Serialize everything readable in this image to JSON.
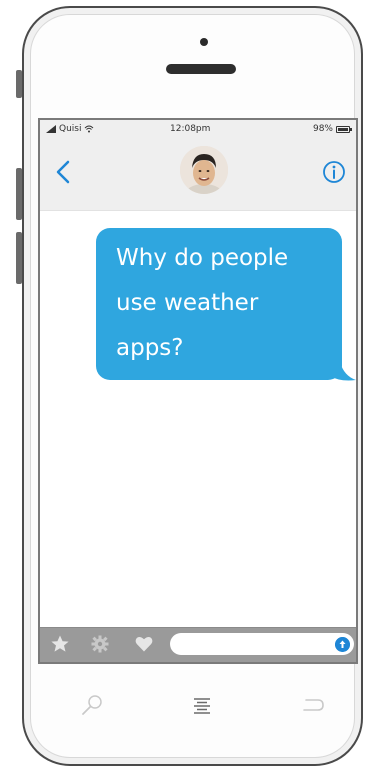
{
  "status_bar": {
    "carrier": "Quisi",
    "time": "12:08pm",
    "battery": "98%"
  },
  "header": {
    "back_icon": "chevron-left-icon",
    "info_icon": "info-circle-icon",
    "avatar_icon": "contact-avatar"
  },
  "conversation": {
    "messages": [
      {
        "sender": "me",
        "lines": [
          "Why do people",
          "use weather",
          "apps?"
        ]
      }
    ]
  },
  "compose_bar": {
    "tools": [
      "star-icon",
      "gear-icon",
      "heart-icon"
    ],
    "input_value": "",
    "input_placeholder": "",
    "send_icon": "send-arrow-icon"
  },
  "home_buttons": [
    "search-icon",
    "menu-icon",
    "return-icon"
  ],
  "colors": {
    "bubble": "#2fa6df",
    "accent": "#1e86d6",
    "header_bg": "#efefef",
    "compose_bg": "#9a9a9a"
  }
}
